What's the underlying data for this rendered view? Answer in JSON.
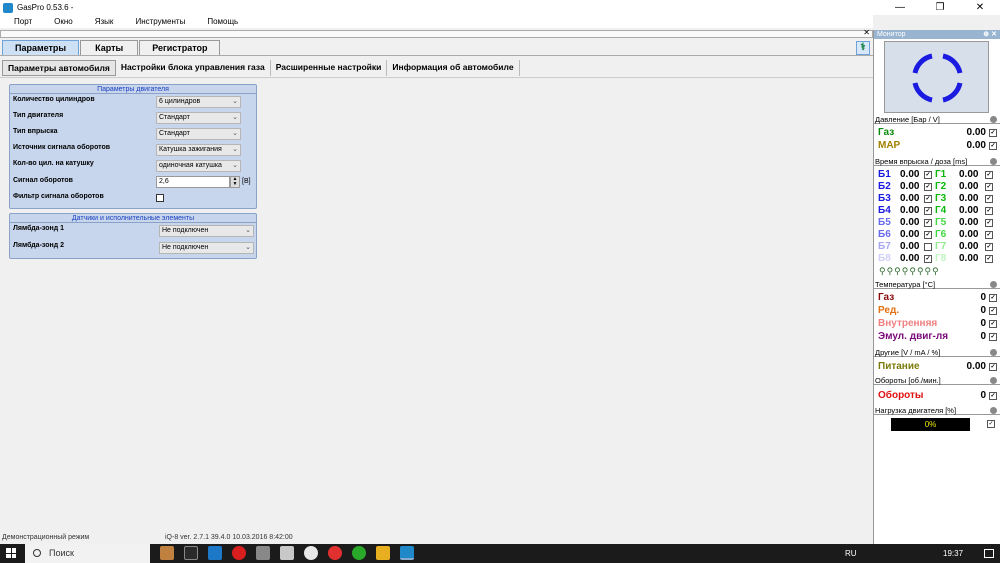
{
  "window": {
    "title": "GasPro 0.53.6 -",
    "min": "—",
    "max": "❐",
    "close": "✕"
  },
  "menu": [
    "Порт",
    "Окно",
    "Язык",
    "Инструменты",
    "Помощь"
  ],
  "main_tabs": [
    "Параметры",
    "Карты",
    "Регистратор"
  ],
  "sub_tabs": [
    "Параметры автомобиля",
    "Настройки блока управления газа",
    "Расширенные настройки",
    "Информация об автомобиле"
  ],
  "engine_group": {
    "title": "Параметры двигателя",
    "rows": [
      {
        "label": "Количество цилиндров",
        "value": "6 цилиндров"
      },
      {
        "label": "Тип двигателя",
        "value": "Стандарт"
      },
      {
        "label": "Тип впрыска",
        "value": "Стандарт"
      },
      {
        "label": "Источник сигнала оборотов",
        "value": "Катушка зажигания"
      },
      {
        "label": "Кол-во цил. на катушку",
        "value": "одиночная катушка"
      }
    ],
    "rpm_signal_label": "Сигнал оборотов",
    "rpm_signal_value": "2,6",
    "rpm_signal_unit": "[B]",
    "rpm_filter_label": "Фильтр сигнала оборотов"
  },
  "sensors_group": {
    "title": "Датчики и исполнительные элементы",
    "rows": [
      {
        "label": "Лямбда-зонд 1",
        "value": "Не подключен"
      },
      {
        "label": "Лямбда-зонд 2",
        "value": "Не подключен"
      }
    ]
  },
  "status": {
    "mode": "Демонстрационный режим",
    "version": "iQ-8  ver. 2.7.1  39.4.0   10.03.2016 8:42:00"
  },
  "monitor": {
    "title": "Монитор",
    "pin": "⊕",
    "close": "✕",
    "pressure_title": "Давление [Бар / V]",
    "pressure": [
      {
        "label": "Газ",
        "value": "0.00",
        "color": "#0a8a0a"
      },
      {
        "label": "MAP",
        "value": "0.00",
        "color": "#a08000"
      }
    ],
    "injection_title": "Время впрыска / доза [ms]",
    "injectors": [
      {
        "b": "Б1",
        "bv": "0.00",
        "g": "Г1",
        "gv": "0.00",
        "bc": "#1a1ae0",
        "gc": "#0ab80a"
      },
      {
        "b": "Б2",
        "bv": "0.00",
        "g": "Г2",
        "gv": "0.00",
        "bc": "#1a1ae0",
        "gc": "#0ab80a"
      },
      {
        "b": "Б3",
        "bv": "0.00",
        "g": "Г3",
        "gv": "0.00",
        "bc": "#1a1ae0",
        "gc": "#0ab80a"
      },
      {
        "b": "Б4",
        "bv": "0.00",
        "g": "Г4",
        "gv": "0.00",
        "bc": "#1a1ae0",
        "gc": "#0ab80a"
      },
      {
        "b": "Б5",
        "bv": "0.00",
        "g": "Г5",
        "gv": "0.00",
        "bc": "#6a6aee",
        "gc": "#40d840"
      },
      {
        "b": "Б6",
        "bv": "0.00",
        "g": "Г6",
        "gv": "0.00",
        "bc": "#6a6aee",
        "gc": "#40d840"
      },
      {
        "b": "Б7",
        "bv": "0.00",
        "g": "Г7",
        "gv": "0.00",
        "bc": "#a8a8f0",
        "gc": "#90ea90"
      },
      {
        "b": "Б8",
        "bv": "0.00",
        "g": "Г8",
        "gv": "0.00",
        "bc": "#d0d0f8",
        "gc": "#c0f4c0"
      }
    ],
    "temperature_title": "Температура [°C]",
    "temperatures": [
      {
        "label": "Газ",
        "value": "0",
        "color": "#8a0a0a"
      },
      {
        "label": "Ред.",
        "value": "0",
        "color": "#e07010"
      },
      {
        "label": "Внутренняя",
        "value": "0",
        "color": "#f08080"
      },
      {
        "label": "Эмул. двиг-ля",
        "value": "0",
        "color": "#7a0a7a"
      }
    ],
    "other_title": "Другие [V / mA / %]",
    "other": [
      {
        "label": "Питание",
        "value": "0.00",
        "color": "#7a7a0a"
      }
    ],
    "rpm_title": "Обороты [об./мин.]",
    "rpm": [
      {
        "label": "Обороты",
        "value": "0",
        "color": "#e01010"
      }
    ],
    "load_title": "Нагрузка двигателя [%]",
    "load_value": "0%"
  },
  "taskbar": {
    "search": "Поиск",
    "lang": "RU",
    "time": "19:37"
  }
}
